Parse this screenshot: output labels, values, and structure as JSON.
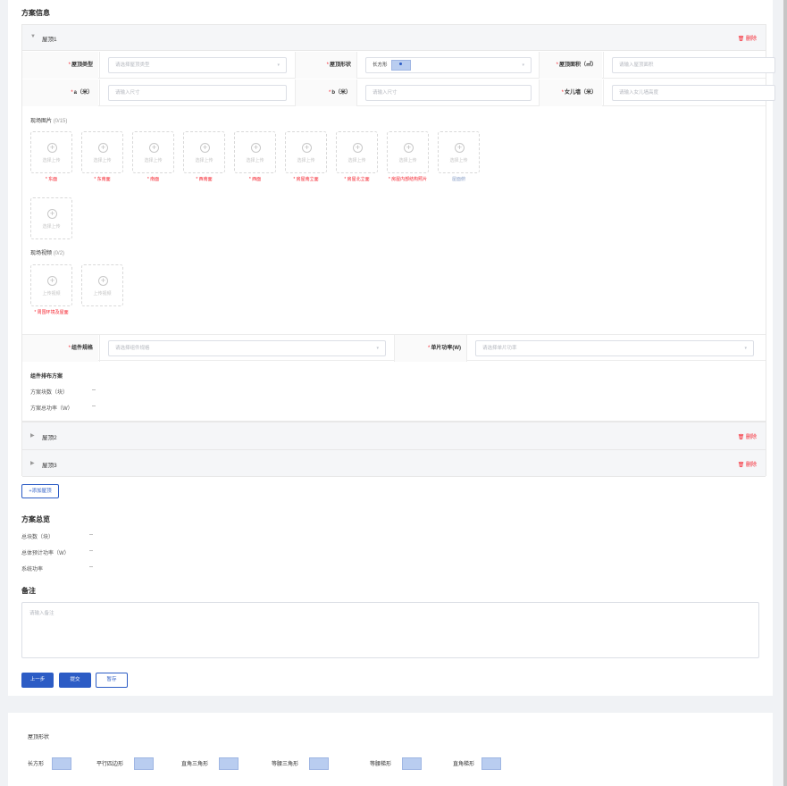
{
  "section_title": "方案信息",
  "delete_label": "删除",
  "roof1": {
    "name": "屋顶1",
    "type_label": "屋顶类型",
    "type_placeholder": "请选择屋顶类型",
    "shape_label": "屋顶形状",
    "shape_value": "长方形",
    "area_label": "屋顶面积（㎡）",
    "area_placeholder": "请输入屋顶面积",
    "a_label": "a（米）",
    "a_placeholder": "请输入尺寸",
    "b_label": "b（米）",
    "b_placeholder": "请输入尺寸",
    "wall_label": "女儿墙（米）",
    "wall_placeholder": "请输入女儿墙高度",
    "photos_title": "现场图片",
    "photos_count": "(0/15)",
    "upload_text": "选择上传",
    "photo_captions": [
      {
        "text": "* 东面",
        "required": true
      },
      {
        "text": "* 东南面",
        "required": true
      },
      {
        "text": "* 南面",
        "required": true
      },
      {
        "text": "* 西南面",
        "required": true
      },
      {
        "text": "* 西面",
        "required": true
      },
      {
        "text": "* 房屋南立面",
        "required": true
      },
      {
        "text": "* 房屋北立面",
        "required": true
      },
      {
        "text": "* 房屋内部结构照片",
        "required": true
      },
      {
        "text": "屋面俯",
        "required": false
      }
    ],
    "videos_title": "现场视频",
    "videos_count": "(0/2)",
    "video_upload_text": "上传视频",
    "video_caption": "* 周围环境及屋面",
    "module_label": "组件规格",
    "module_placeholder": "请选择组件规格",
    "power_label": "单片功率(W)",
    "power_placeholder": "请选择单片功率",
    "layout_title": "组件排布方案",
    "count_label": "方案块数（块）",
    "count_value": "--",
    "total_power_label": "方案总功率（W）",
    "total_power_value": "--"
  },
  "roof2": {
    "name": "屋顶2"
  },
  "roof3": {
    "name": "屋顶3"
  },
  "add_roof_label": "+添加屋顶",
  "overview": {
    "title": "方案总览",
    "total_blocks_label": "总块数（块）",
    "total_blocks_value": "--",
    "expected_power_label": "总体预计功率（W）",
    "expected_power_value": "--",
    "system_power_label": "系统功率",
    "system_power_value": "--"
  },
  "remark": {
    "title": "备注",
    "placeholder": "请输入备注"
  },
  "buttons": {
    "prev": "上一步",
    "submit": "提交",
    "save": "暂存"
  },
  "legend": {
    "title": "屋顶形状",
    "shapes": [
      "长方形",
      "平行四边形",
      "直角三角形",
      "等腰三角形",
      "等腰梯形",
      "直角梯形"
    ]
  },
  "colors": {
    "primary": "#2c5cc5",
    "danger": "#f5222d"
  }
}
